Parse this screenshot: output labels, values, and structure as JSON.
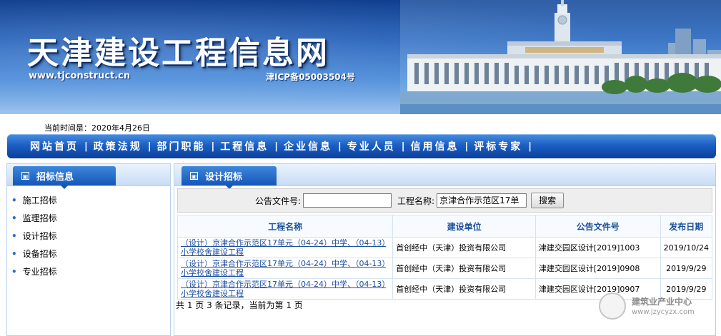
{
  "banner": {
    "title": "天津建设工程信息网",
    "url": "www.tjconstruct.cn",
    "icp": "津ICP备05003504号"
  },
  "time_line": "当前时间是：2020年4月26日",
  "nav": {
    "items": [
      "网站首页",
      "政策法规",
      "部门职能",
      "工程信息",
      "企业信息",
      "专业人员",
      "信用信息",
      "评标专家"
    ],
    "separator": "|"
  },
  "left_panel": {
    "tab_label": "招标信息",
    "items": [
      "施工招标",
      "监理招标",
      "设计招标",
      "设备招标",
      "专业招标"
    ]
  },
  "right_panel": {
    "tab_label": "设计招标",
    "search": {
      "doc_no_label": "公告文件号:",
      "doc_no_value": "",
      "project_label": "工程名称:",
      "project_value": "京津合作示范区17单",
      "search_button": "搜索"
    },
    "table": {
      "headers": [
        "工程名称",
        "建设单位",
        "公告文件号",
        "发布日期"
      ],
      "rows": [
        {
          "name": "（设计）京津合作示范区17单元（04-24）中学、（04-13）小学校舍建设工程",
          "unit": "首创经中（天津）投资有限公司",
          "doc_no": "津建交园区设计[2019]1003",
          "date": "2019/10/24"
        },
        {
          "name": "（设计）京津合作示范区17单元（04-24）中学、（04-13）小学校舍建设工程",
          "unit": "首创经中（天津）投资有限公司",
          "doc_no": "津建交园区设计[2019]0908",
          "date": "2019/9/29"
        },
        {
          "name": "（设计）京津合作示范区17单元（04-24）中学、（04-13）小学校舍建设工程",
          "unit": "首创经中（天津）投资有限公司",
          "doc_no": "津建交园区设计[2019]0907",
          "date": "2019/9/29"
        }
      ]
    },
    "pager": "共 1 页 3 条记录，当前为第 1 页"
  },
  "watermark": {
    "name": "建筑业产业中心",
    "url": "www.jzycyzx.com"
  },
  "colors": {
    "nav_blue": "#1b5fc4",
    "link_blue": "#1f4fa0",
    "header_text": "#1d4f9c"
  }
}
